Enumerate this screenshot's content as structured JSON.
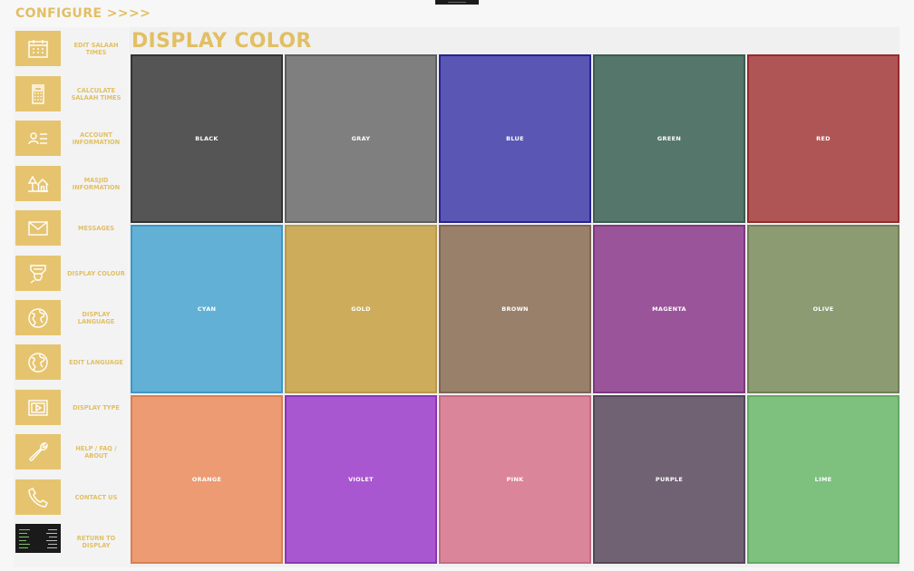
{
  "header": {
    "title": "CONFIGURE >>>>"
  },
  "page": {
    "title": "DISPLAY COLOR"
  },
  "sidebar": {
    "items": [
      {
        "label": "EDIT SALAAH TIMES",
        "icon": "calendar-icon"
      },
      {
        "label": "CALCULATE SALAAH TIMES",
        "icon": "calculator-icon"
      },
      {
        "label": "ACCOUNT INFORMATION",
        "icon": "contact-card-icon"
      },
      {
        "label": "MASJID INFORMATION",
        "icon": "home-icon"
      },
      {
        "label": "MESSAGES",
        "icon": "mail-icon"
      },
      {
        "label": "DISPLAY COLOUR",
        "icon": "highlighter-icon"
      },
      {
        "label": "DISPLAY LANGUAGE",
        "icon": "globe-icon"
      },
      {
        "label": "EDIT LANGUAGE",
        "icon": "globe-icon"
      },
      {
        "label": "DISPLAY TYPE",
        "icon": "video-icon"
      },
      {
        "label": "HELP / FAQ / ABOUT",
        "icon": "wrench-icon"
      },
      {
        "label": "CONTACT US",
        "icon": "phone-icon"
      },
      {
        "label": "RETURN TO DISPLAY",
        "icon": "display-thumbnail"
      }
    ]
  },
  "colors": [
    {
      "label": "BLACK",
      "fill": "#555555",
      "border": "#333333"
    },
    {
      "label": "GRAY",
      "fill": "#7f7f7f",
      "border": "#5e5e5e"
    },
    {
      "label": "BLUE",
      "fill": "#5957b3",
      "border": "#26248f"
    },
    {
      "label": "GREEN",
      "fill": "#55766a",
      "border": "#3c5c4f"
    },
    {
      "label": "RED",
      "fill": "#b05555",
      "border": "#962a2a"
    },
    {
      "label": "CYAN",
      "fill": "#63b0d7",
      "border": "#3f96c6"
    },
    {
      "label": "GOLD",
      "fill": "#cdad5c",
      "border": "#b79a4b"
    },
    {
      "label": "BROWN",
      "fill": "#98806a",
      "border": "#7d6552"
    },
    {
      "label": "MAGENTA",
      "fill": "#9a549a",
      "border": "#7f387f"
    },
    {
      "label": "OLIVE",
      "fill": "#8c9b72",
      "border": "#707e56"
    },
    {
      "label": "ORANGE",
      "fill": "#ec9b72",
      "border": "#d97f55"
    },
    {
      "label": "VIOLET",
      "fill": "#a957d1",
      "border": "#8b35b6"
    },
    {
      "label": "PINK",
      "fill": "#db859b",
      "border": "#c56b83"
    },
    {
      "label": "PURPLE",
      "fill": "#706273",
      "border": "#53465a"
    },
    {
      "label": "LIME",
      "fill": "#7ec17e",
      "border": "#63a963"
    }
  ],
  "theme": {
    "accent": "#e2bf63",
    "tile": "#e6c46f"
  }
}
